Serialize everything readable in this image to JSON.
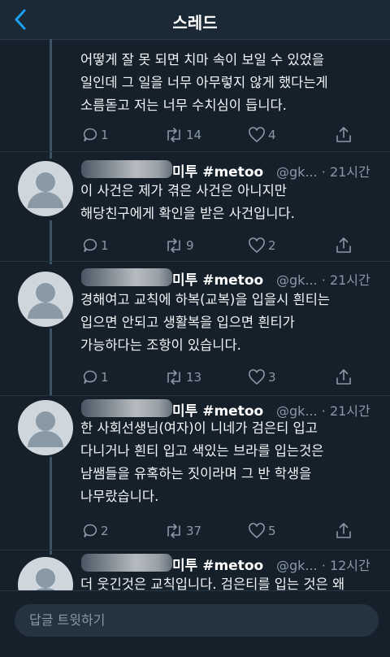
{
  "header": {
    "title": "스레드"
  },
  "tweets": [
    {
      "name": "",
      "handle": "",
      "time": "",
      "lines": [
        "어떻게 잘 못 되면 치마 속이 보일 수 있었을",
        "일인데 그 일을 너무 아무렇지 않게 했다는게",
        "소름돋고 저는 너무 수치심이 듭니다."
      ],
      "replies": "1",
      "retweets": "14",
      "likes": "4"
    },
    {
      "name": "미투 #metoo",
      "handle": "@gk... · 21시간",
      "time": "21시간",
      "lines": [
        "이 사건은 제가 겪은 사건은 아니지만",
        "해당친구에게 확인을 받은 사건입니다."
      ],
      "replies": "1",
      "retweets": "9",
      "likes": "2"
    },
    {
      "name": "미투 #metoo",
      "handle": "@gk... · 21시간",
      "time": "21시간",
      "lines": [
        "경해여고 교칙에 하복(교복)을 입을시 흰티는",
        "입으면 안되고 생활복을 입으면 흰티가",
        "가능하다는 조항이 있습니다."
      ],
      "replies": "1",
      "retweets": "13",
      "likes": "3"
    },
    {
      "name": "미투 #metoo",
      "handle": "@gk... · 21시간",
      "time": "21시간",
      "lines": [
        "한 사회선생님(여자)이 니네가 검은티 입고",
        "다니거나 흰티 입고 색있는 브라를 입는것은",
        "남쌤들을 유혹하는 짓이라며 그 반 학생을",
        "나무랐습니다."
      ],
      "replies": "2",
      "retweets": "37",
      "likes": "5"
    },
    {
      "name": "미투 #metoo",
      "handle": "@gk... · 12시간",
      "time": "12시간",
      "lines": [
        "더 웃긴것은 교칙입니다. 검은티를 입는 것은 왜"
      ],
      "replies": "",
      "retweets": "",
      "likes": ""
    }
  ],
  "reply_bar": {
    "placeholder": "답글 트윗하기"
  },
  "colors": {
    "background": "#15202b",
    "accent": "#1da1f2",
    "muted": "#8899a6"
  }
}
